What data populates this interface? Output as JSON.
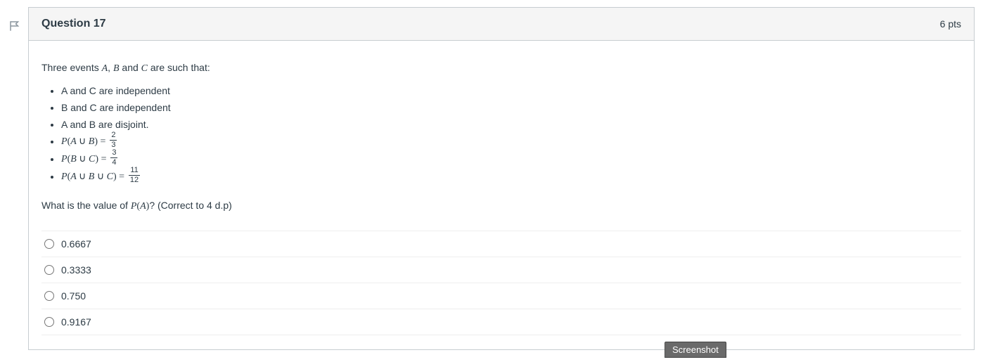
{
  "header": {
    "title": "Question 17",
    "points": "6 pts"
  },
  "body": {
    "intro_prefix": "Three events ",
    "intro_mid1": ", ",
    "intro_mid2": " and ",
    "intro_suffix": " are such that:",
    "A": "A",
    "B": "B",
    "C": "C",
    "bullets": {
      "b1": "A and C are independent",
      "b2": "B and C are independent",
      "b3": "A and B are disjoint.",
      "p_ab_lhs": "P(A ∪ B) = ",
      "p_ab_num": "2",
      "p_ab_den": "3",
      "p_bc_lhs": "P(B ∪ C) = ",
      "p_bc_num": "3",
      "p_bc_den": "4",
      "p_abc_lhs": "P(A ∪ B ∪ C) = ",
      "p_abc_num": "11",
      "p_abc_den": "12"
    },
    "final_q_prefix": "What is the value of ",
    "final_q_math": "P(A)",
    "final_q_suffix": "? (Correct to 4 d.p)"
  },
  "answers": [
    "0.6667",
    "0.3333",
    "0.750",
    "0.9167"
  ],
  "badge": "Screenshot"
}
